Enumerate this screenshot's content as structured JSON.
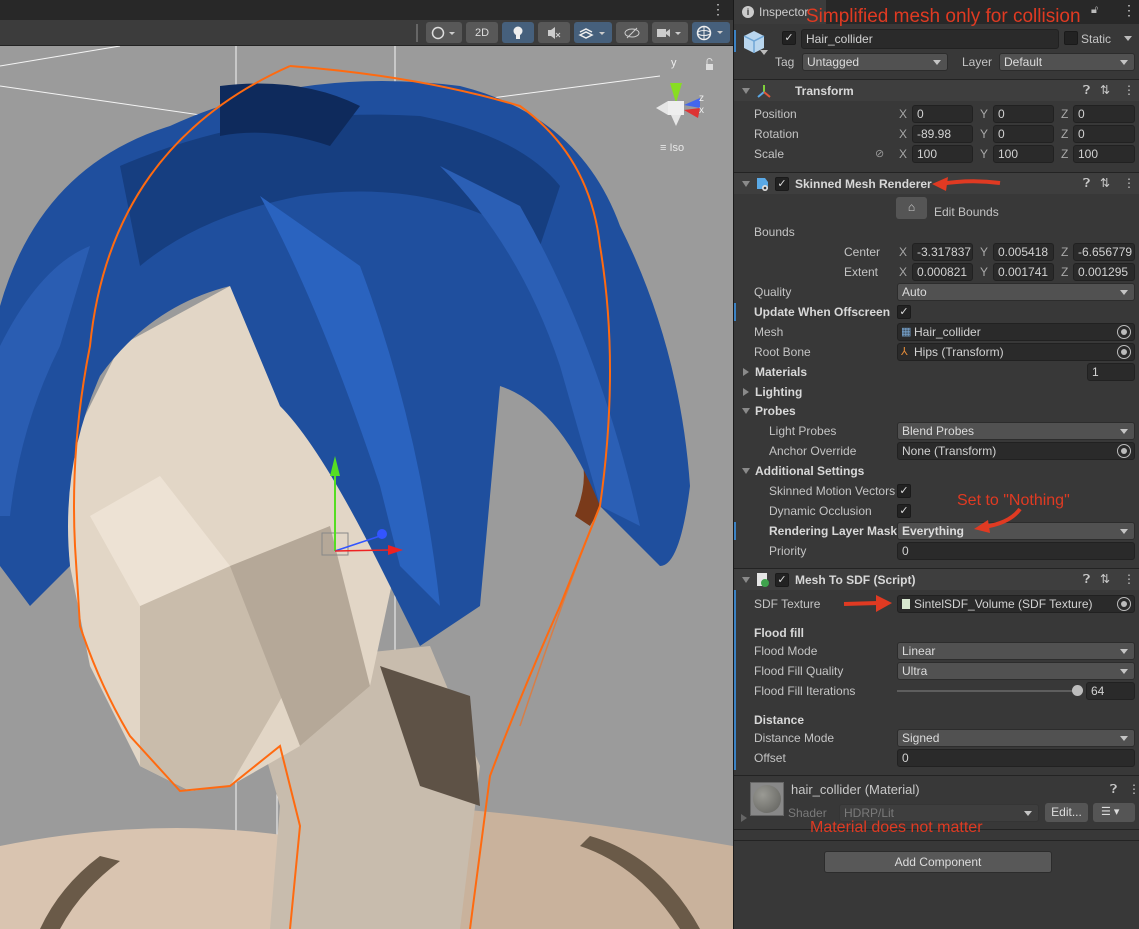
{
  "scene": {
    "toolbar": {
      "shading_label": "",
      "mode_2d_label": "2D",
      "lighting_toggle": "light-bulb",
      "audio_toggle": "audio-mute",
      "effects_toggle": "effects",
      "visibility_toggle": "scene-visibility",
      "camera_toggle": "camera",
      "gizmos_toggle": "gizmos"
    },
    "gizmo": {
      "y_label": "y",
      "z_label": "z",
      "x_label": "x",
      "projection_label": "Iso"
    }
  },
  "inspector": {
    "tab_label": "Inspector",
    "object": {
      "active": true,
      "name": "Hair_collider",
      "static_label": "Static",
      "static": false,
      "tag_label": "Tag",
      "tag_value": "Untagged",
      "layer_label": "Layer",
      "layer_value": "Default"
    },
    "transform": {
      "title": "Transform",
      "position_label": "Position",
      "rotation_label": "Rotation",
      "scale_label": "Scale",
      "position": {
        "x": "0",
        "y": "0",
        "z": "0"
      },
      "rotation": {
        "x": "-89.98",
        "y": "0",
        "z": "0"
      },
      "scale": {
        "x": "100",
        "y": "100",
        "z": "100"
      },
      "axis_x": "X",
      "axis_y": "Y",
      "axis_z": "Z"
    },
    "skinned_mesh_renderer": {
      "title": "Skinned Mesh Renderer",
      "enabled": true,
      "edit_bounds_label": "Edit Bounds",
      "bounds_label": "Bounds",
      "center_label": "Center",
      "extent_label": "Extent",
      "center": {
        "x": "-3.317837",
        "y": "0.005418",
        "z": "-6.656779"
      },
      "extent": {
        "x": "0.000821",
        "y": "0.001741",
        "z": "0.001295"
      },
      "quality_label": "Quality",
      "quality_value": "Auto",
      "update_offscreen_label": "Update When Offscreen",
      "update_offscreen": true,
      "mesh_label": "Mesh",
      "mesh_value": "Hair_collider",
      "root_bone_label": "Root Bone",
      "root_bone_value": "Hips (Transform)",
      "materials_label": "Materials",
      "materials_count": "1",
      "lighting_label": "Lighting",
      "probes_label": "Probes",
      "light_probes_label": "Light Probes",
      "light_probes_value": "Blend Probes",
      "anchor_override_label": "Anchor Override",
      "anchor_override_value": "None (Transform)",
      "additional_settings_label": "Additional Settings",
      "skinned_motion_label": "Skinned Motion Vectors",
      "skinned_motion": true,
      "dynamic_occlusion_label": "Dynamic Occlusion",
      "dynamic_occlusion": true,
      "rendering_layer_label": "Rendering Layer Mask",
      "rendering_layer_value": "Everything",
      "priority_label": "Priority",
      "priority_value": "0"
    },
    "mesh_to_sdf": {
      "title": "Mesh To SDF (Script)",
      "enabled": true,
      "sdf_texture_label": "SDF Texture",
      "sdf_texture_value": "SintelSDF_Volume (SDF Texture)",
      "flood_fill_header": "Flood fill",
      "flood_mode_label": "Flood Mode",
      "flood_mode_value": "Linear",
      "flood_quality_label": "Flood Fill Quality",
      "flood_quality_value": "Ultra",
      "flood_iterations_label": "Flood Fill Iterations",
      "flood_iterations_value": "64",
      "flood_iterations_fraction": 1.0,
      "distance_header": "Distance",
      "distance_mode_label": "Distance Mode",
      "distance_mode_value": "Signed",
      "offset_label": "Offset",
      "offset_value": "0"
    },
    "material": {
      "name": "hair_collider (Material)",
      "shader_label": "Shader",
      "shader_value": "HDRP/Lit",
      "edit_label": "Edit..."
    },
    "add_component_label": "Add Component"
  },
  "annotations": {
    "top": "Simplified mesh only for collision",
    "rendering_layer": "Set to \"Nothing\"",
    "material": "Material does not matter",
    "color": "#e03a22"
  }
}
